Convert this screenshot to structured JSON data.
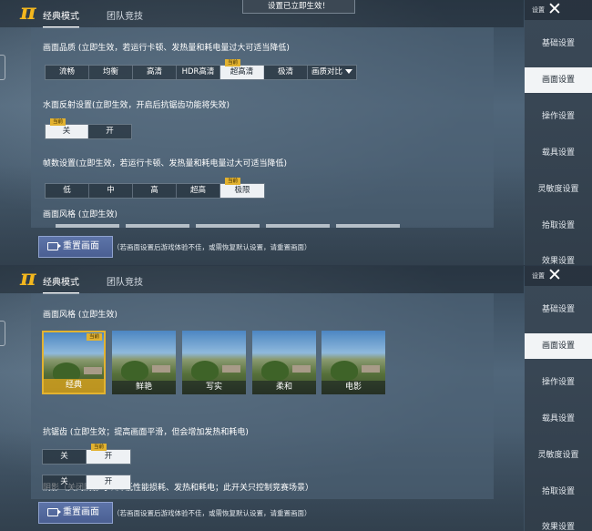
{
  "common": {
    "mode_tabs": [
      "经典模式",
      "团队竞技"
    ],
    "current_badge": "当前",
    "close_label": "设置",
    "reset_button": "重置画面",
    "reset_note": "（若画面设置后游戏体验不佳，或需恢复默认设置，请重置画面）"
  },
  "toast": "设置已立即生效！",
  "sidebar": {
    "items": [
      "基础设置",
      "画面设置",
      "操作设置",
      "载具设置",
      "灵敏度设置",
      "拾取设置",
      "效果设置"
    ],
    "active": "画面设置"
  },
  "top_panel": {
    "quality": {
      "label": "画面品质 (立即生效，若运行卡顿、发热量和耗电量过大可适当降低)",
      "options": [
        "流畅",
        "均衡",
        "高清",
        "HDR高清",
        "超高清",
        "极清",
        "画质对比"
      ],
      "selected": "超高清"
    },
    "water": {
      "label": "水面反射设置(立即生效，开启后抗锯齿功能将失效)",
      "options": [
        "关",
        "开"
      ],
      "selected": "关"
    },
    "fps": {
      "label": "帧数设置(立即生效，若运行卡顿、发热量和耗电量过大可适当降低)",
      "options": [
        "低",
        "中",
        "高",
        "超高",
        "极限"
      ],
      "selected": "极限"
    },
    "style_label": "画面风格 (立即生效)"
  },
  "bottom_panel": {
    "style": {
      "label": "画面风格 (立即生效)",
      "options": [
        "经典",
        "鲜艳",
        "写实",
        "柔和",
        "电影"
      ],
      "selected": "经典"
    },
    "antialias": {
      "label": "抗锯齿 (立即生效；提高画面平滑，但会增加发热和耗电)",
      "options": [
        "关",
        "开"
      ],
      "selected": "开"
    },
    "shadow": {
      "label": "阴影（关闭阴影可以降低性能损耗、发热和耗电；此开关只控制竞赛场景）",
      "options": [
        "关",
        "开"
      ],
      "selected": "开"
    }
  }
}
